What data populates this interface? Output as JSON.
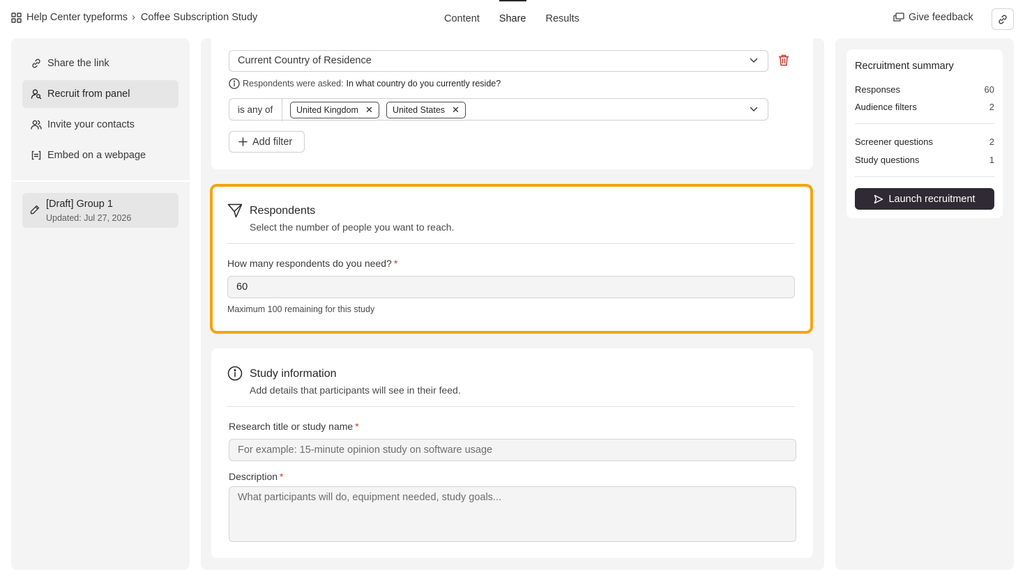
{
  "breadcrumb": {
    "workspace": "Help Center typeforms",
    "separator": "›",
    "form": "Coffee Subscription Study"
  },
  "tabs": [
    {
      "label": "Content",
      "active": false
    },
    {
      "label": "Share",
      "active": true
    },
    {
      "label": "Results",
      "active": false
    }
  ],
  "header": {
    "feedback_label": "Give feedback"
  },
  "sidebar": {
    "items": [
      {
        "label": "Share the link",
        "icon": "link-icon"
      },
      {
        "label": "Recruit from panel",
        "icon": "user-search-icon",
        "active": true
      },
      {
        "label": "Invite your contacts",
        "icon": "users-icon"
      },
      {
        "label": "Embed on a webpage",
        "icon": "embed-icon"
      }
    ],
    "group": {
      "title": "[Draft] Group 1",
      "updated": "Updated: Jul 27, 2026"
    }
  },
  "filter": {
    "question": "Current Country of Residence",
    "asked_prefix": "Respondents were asked:",
    "asked_question": "In what country do you currently reside?",
    "operator": "is any of",
    "chips": [
      "United Kingdom",
      "United States"
    ],
    "add_filter_label": "Add filter"
  },
  "respondents": {
    "title": "Respondents",
    "subtitle": "Select the number of people you want to reach.",
    "label": "How many respondents do you need?",
    "required_mark": "*",
    "value": "60",
    "hint": "Maximum 100 remaining for this study"
  },
  "study_info": {
    "title": "Study information",
    "subtitle": "Add details that participants will see in their feed.",
    "title_label": "Research title or study name",
    "title_placeholder": "For example: 15-minute opinion study on software usage",
    "description_label": "Description",
    "description_placeholder": "What participants will do, equipment needed, study goals...",
    "required_mark": "*"
  },
  "summary": {
    "title": "Recruitment summary",
    "rows": [
      {
        "label": "Responses",
        "value": "60"
      },
      {
        "label": "Audience filters",
        "value": "2"
      },
      {
        "label": "Screener questions",
        "value": "2"
      },
      {
        "label": "Study questions",
        "value": "1"
      }
    ],
    "launch_label": "Launch recruitment"
  },
  "colors": {
    "highlight": "#f5a40b",
    "launch_bg": "#2f2a33",
    "danger": "#c0392b"
  }
}
